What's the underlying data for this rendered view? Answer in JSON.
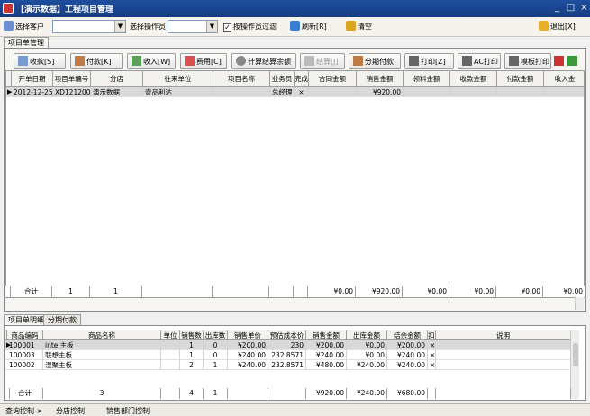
{
  "window": {
    "title": "【演示数据】工程项目管理",
    "controls": [
      "_",
      "□",
      "×"
    ]
  },
  "toolbar": {
    "select_customer_label": "选择客户",
    "select_operator_label": "选择操作员",
    "filter_by_operator_label": "按操作员过滤",
    "filter_checked": "✓",
    "refresh_label": "刷新[R]",
    "clear_label": "清空",
    "exit_label": "退出[X]"
  },
  "top_tabs": [
    "项目单管理"
  ],
  "actions": {
    "receive": "收款[S]",
    "pay": "付款[K]",
    "income": "收入[W]",
    "expense": "费用[C]",
    "calc_balance": "计算结算余额",
    "settle": "结算[J]",
    "installment_pay": "分期付款",
    "print": "打印[Z]",
    "ac_print": "AC打印",
    "template_print": "模板打印"
  },
  "main_grid": {
    "headers": [
      "开单日期",
      "项目单编号",
      "分店",
      "往来单位",
      "项目名称",
      "业务员",
      "完成",
      "合同金额",
      "销售金额",
      "领料金额",
      "收款金额",
      "付款金额",
      "收入金"
    ],
    "rows": [
      [
        "2012-12-25",
        "XD12120001",
        "演示数据",
        "壹品利达",
        "",
        "总经理",
        "×",
        "",
        "¥920.00",
        "",
        "",
        "",
        ""
      ]
    ],
    "footer": [
      "合计",
      "1",
      "1",
      "",
      "",
      "",
      "",
      "¥0.00",
      "¥920.00",
      "¥0.00",
      "¥0.00",
      "¥0.00",
      "¥0.00"
    ]
  },
  "bottom_tabs": [
    "项目单明细",
    "分期付款"
  ],
  "detail_grid": {
    "headers": [
      "商品编码",
      "商品名称",
      "单位",
      "销售数",
      "出库数",
      "销售单价",
      "预估成本价",
      "销售金额",
      "出库金额",
      "结余金额",
      "扣",
      "说明"
    ],
    "rows": [
      [
        "100001",
        "intel主板",
        "",
        "1",
        "0",
        "¥200.00",
        "230",
        "¥200.00",
        "¥0.00",
        "¥200.00",
        "×",
        ""
      ],
      [
        "100003",
        "联想主板",
        "",
        "1",
        "0",
        "¥240.00",
        "232.8571",
        "¥240.00",
        "¥0.00",
        "¥240.00",
        "×",
        ""
      ],
      [
        "100002",
        "湿聚主板",
        "",
        "2",
        "1",
        "¥240.00",
        "232.8571",
        "¥480.00",
        "¥240.00",
        "¥240.00",
        "×",
        ""
      ]
    ],
    "footer": [
      "合计",
      "3",
      "",
      "4",
      "1",
      "",
      "",
      "¥920.00",
      "¥240.00",
      "¥680.00",
      "",
      ""
    ]
  },
  "statusbar": {
    "query_control": "查询控制->",
    "branch_control": "分店控制",
    "sales_dept_control": "销售部门控制"
  },
  "colors": {
    "titlebar": "#1f4e9e",
    "selected_row": "#d9d9d9"
  }
}
